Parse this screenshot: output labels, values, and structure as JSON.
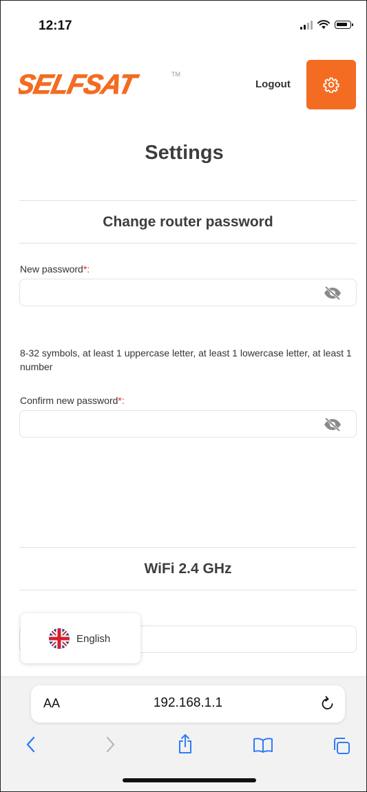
{
  "status_bar": {
    "time": "12:17"
  },
  "header": {
    "logo_text": "SELFSAT",
    "logo_tm": "TM",
    "logout_label": "Logout",
    "brand_color": "#f36c21"
  },
  "page": {
    "title": "Settings"
  },
  "router_section": {
    "title": "Change router password",
    "new_password": {
      "label": "New password",
      "required_mark": "*",
      "colon": ":",
      "value": ""
    },
    "hint": "8-32 symbols, at least 1 uppercase letter, at least 1 lowercase letter, at least 1 number",
    "confirm_password": {
      "label": "Confirm new password",
      "required_mark": "*",
      "colon": ":",
      "value": ""
    }
  },
  "wifi_section": {
    "title": "WiFi 2.4 GHz"
  },
  "language_popup": {
    "label": "English",
    "flag_icon": "uk-flag-icon"
  },
  "browser": {
    "text_size_label": "AA",
    "url": "192.168.1.1",
    "icons": [
      "back-icon",
      "forward-icon",
      "share-icon",
      "bookmarks-icon",
      "tabs-icon",
      "reload-icon"
    ]
  }
}
